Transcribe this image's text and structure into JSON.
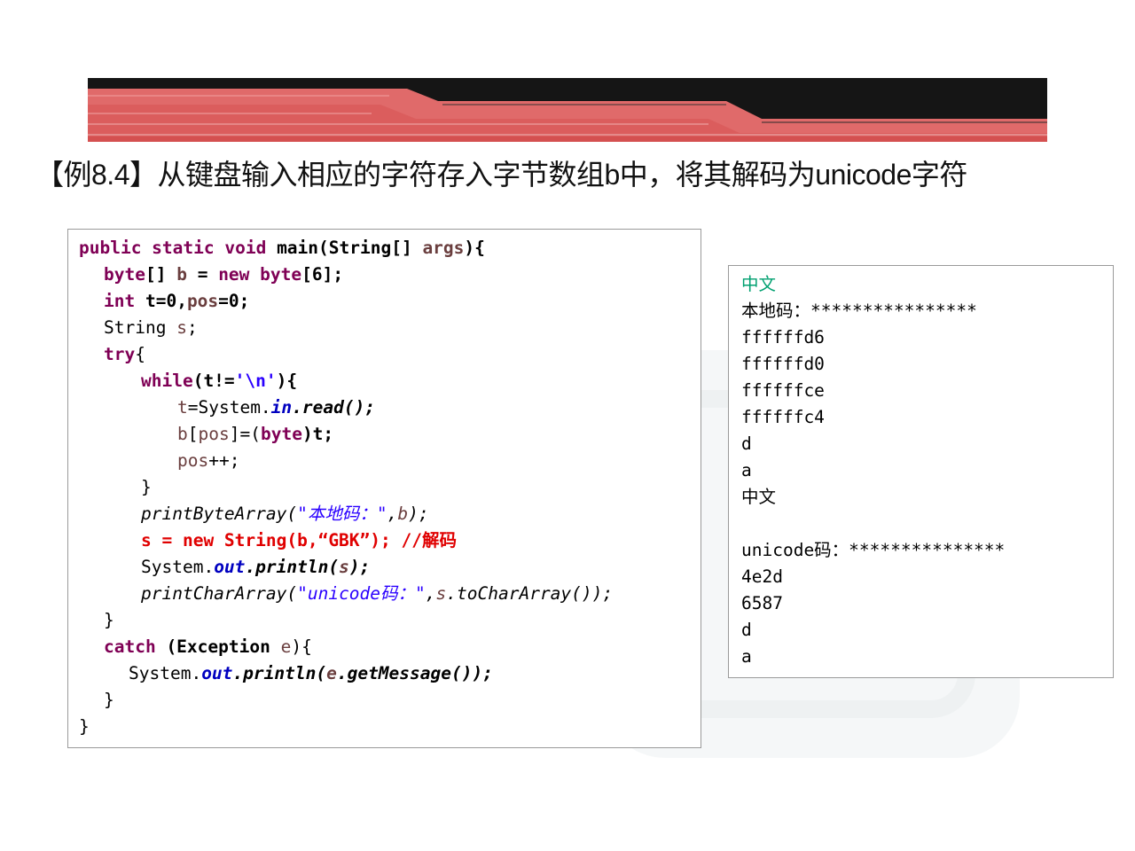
{
  "title": "【例8.4】从键盘输入相应的字符存入字节数组b中，将其解码为unicode字符",
  "code": {
    "l1": {
      "a": "public static void",
      "b": " main(String[] ",
      "c": "args",
      "d": "){"
    },
    "l2": {
      "a": "byte",
      "b": "[] ",
      "c": "b",
      "d": " = ",
      "e": "new byte",
      "f": "[6];"
    },
    "l3": {
      "a": "int",
      "b": " t=0,",
      "c": "pos",
      "d": "=0;"
    },
    "l4": {
      "a": "String ",
      "b": "s",
      "c": ";"
    },
    "l5": {
      "a": "try",
      "b": "{"
    },
    "l6": {
      "a": "while",
      "b": "(t!=",
      "c": "'\\n'",
      "d": "){"
    },
    "l7": {
      "a": "t",
      "b": "=System.",
      "c": "in",
      "d": ".read();"
    },
    "l8": {
      "a": "b",
      "b": "[",
      "c": "pos",
      "d": "]=(",
      "e": "byte",
      "f": ")t;"
    },
    "l9": {
      "a": "pos",
      "b": "++;"
    },
    "l10": "}",
    "l11": {
      "a": "printByteArray(",
      "b": "\"本地码：\"",
      "c": ",",
      "d": "b",
      "e": ");"
    },
    "l12": "s = new String(b,“GBK”); //解码",
    "l13": {
      "a": "System.",
      "b": "out",
      "c": ".println(",
      "d": "s",
      "e": ");"
    },
    "l14": {
      "a": "printCharArray(",
      "b": "\"unicode码：\"",
      "c": ",",
      "d": "s",
      "e": ".toCharArray());"
    },
    "l15": "}",
    "l16": {
      "a": "catch",
      "b": " (Exception ",
      "c": "e",
      "d": "){"
    },
    "l17": {
      "a": "System.",
      "b": "out",
      "c": ".println(",
      "d": "e",
      "e": ".getMessage());"
    },
    "l18": "}",
    "l19": "}"
  },
  "output": {
    "lines": [
      "中文",
      "本地码：****************",
      "ffffffd6",
      "ffffffd0",
      "ffffffce",
      "ffffffc4",
      "d",
      "a",
      "中文",
      "",
      "unicode码：***************",
      "4e2d",
      "6587",
      "d",
      "a"
    ]
  }
}
